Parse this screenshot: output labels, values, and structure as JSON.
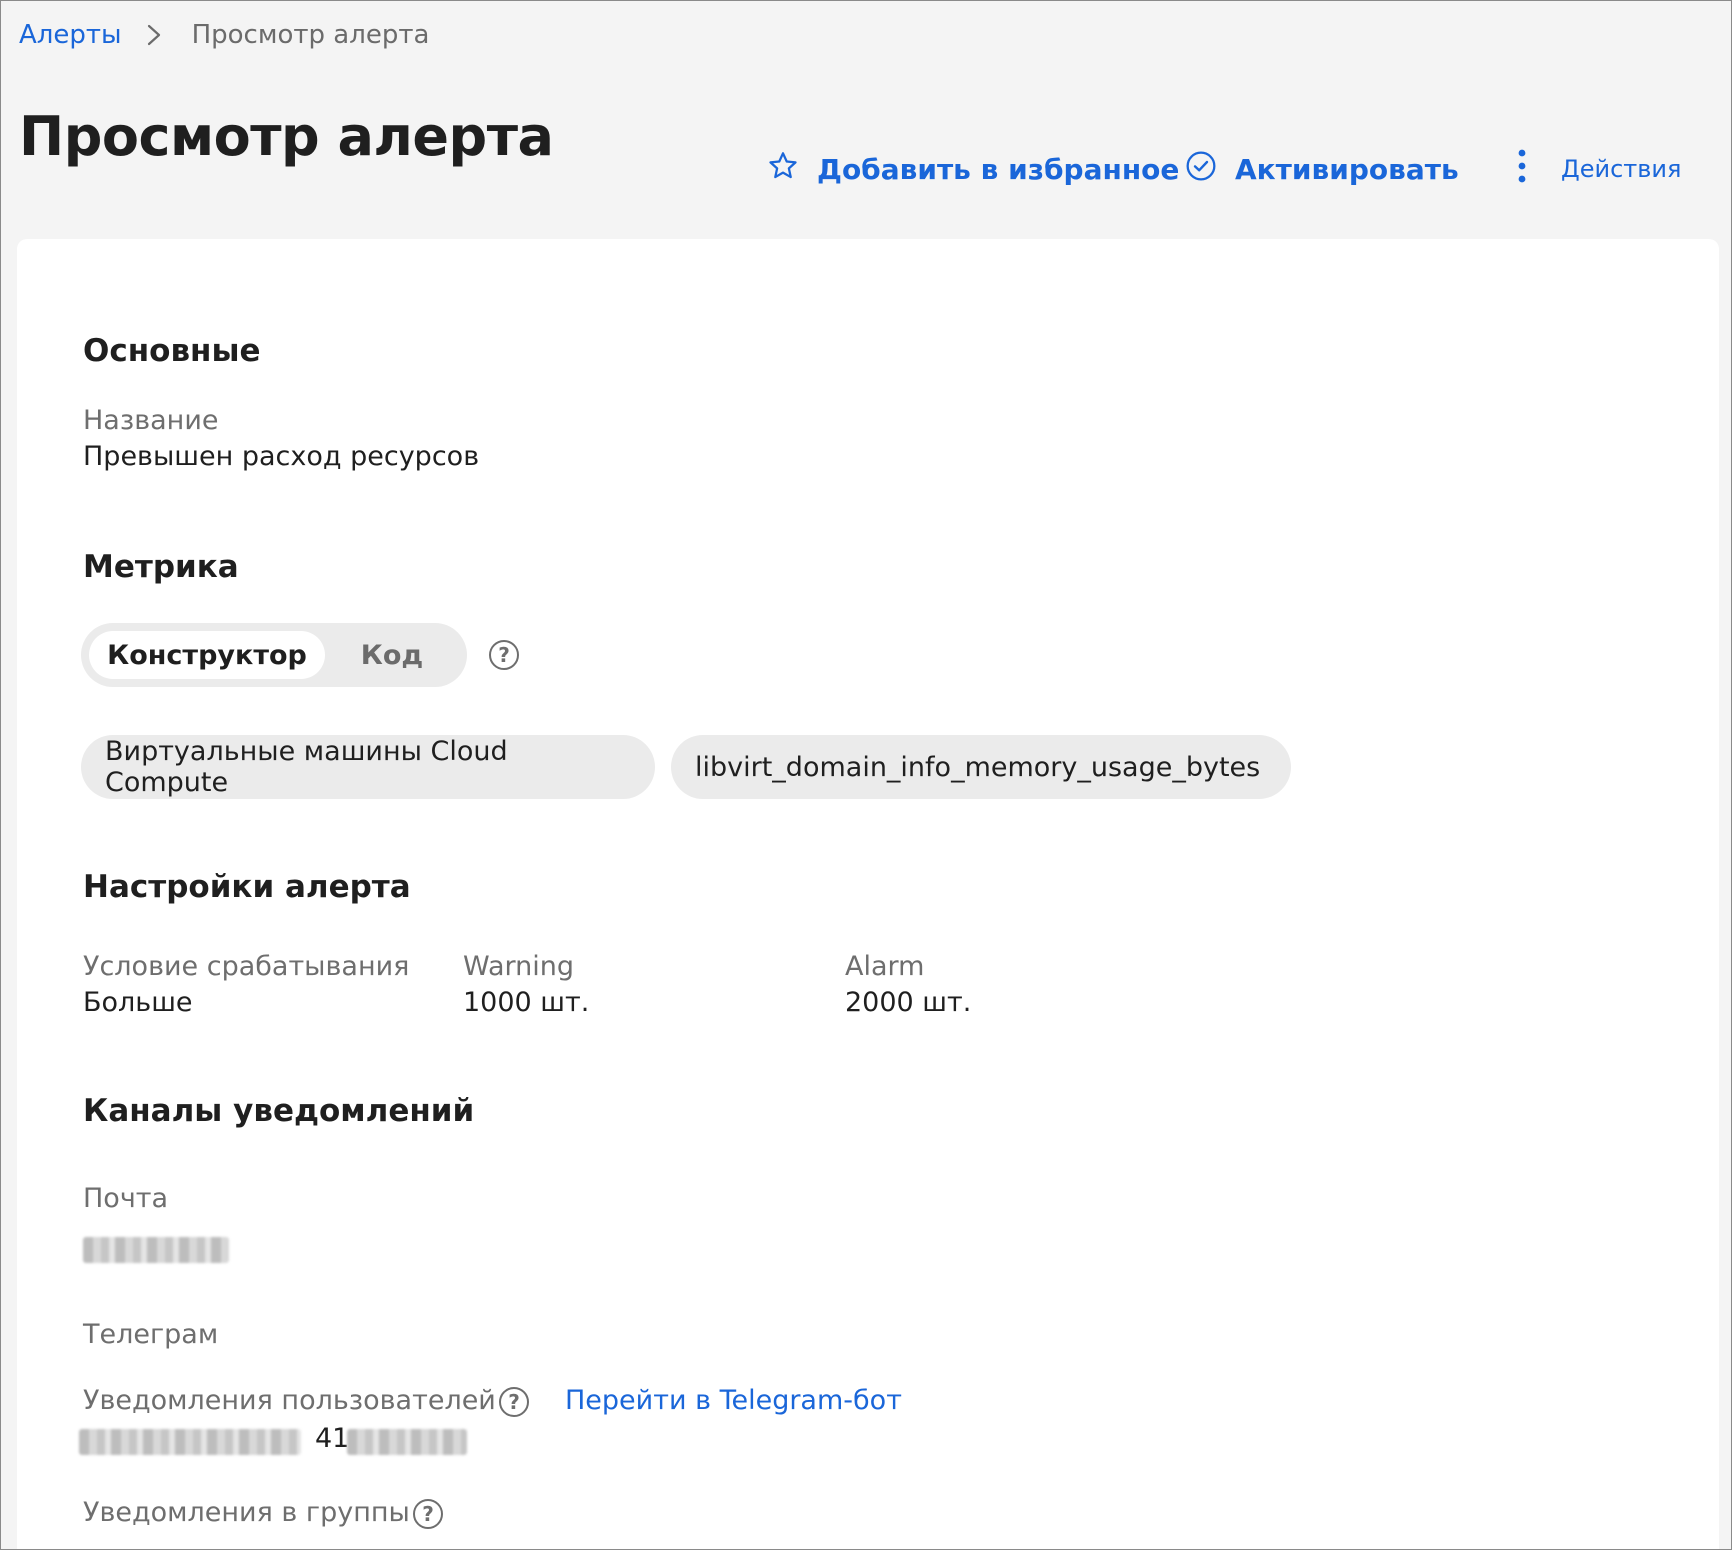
{
  "breadcrumb": {
    "parent": "Алерты",
    "current": "Просмотр алерта"
  },
  "header": {
    "title": "Просмотр алерта",
    "favorite_label": "Добавить в избранное",
    "activate_label": "Активировать",
    "actions_label": "Действия"
  },
  "sections": {
    "main": {
      "title": "Основные",
      "name_label": "Название",
      "name_value": "Превышен расход ресурсов"
    },
    "metric": {
      "title": "Метрика",
      "tabs": [
        "Конструктор",
        "Код"
      ],
      "active_tab": "Конструктор",
      "chips": [
        "Виртуальные машины Cloud Compute",
        "libvirt_domain_info_memory_usage_bytes"
      ]
    },
    "settings": {
      "title": "Настройки алерта",
      "condition_label": "Условие срабатывания",
      "condition_value": "Больше",
      "warning_label": "Warning",
      "warning_value": "1000 шт.",
      "alarm_label": "Alarm",
      "alarm_value": "2000 шт."
    },
    "channels": {
      "title": "Каналы уведомлений",
      "mail_label": "Почта",
      "telegram_label": "Телеграм",
      "user_notifications_label": "Уведомления пользователей",
      "telegram_bot_link": "Перейти в Telegram-бот",
      "user_id_prefix": "41",
      "group_notifications_label": "Уведомления в группы"
    }
  },
  "icons": {
    "favorite": "star-icon",
    "activate": "check-circle-icon",
    "actions": "vertical-dots-icon",
    "help": "help-circle-icon",
    "breadcrumb_separator": "chevron-right-icon"
  },
  "colors": {
    "accent": "#1a66d9",
    "background": "#f4f4f4",
    "card": "#ffffff",
    "chip": "#ebebeb"
  },
  "help_glyph": "?"
}
